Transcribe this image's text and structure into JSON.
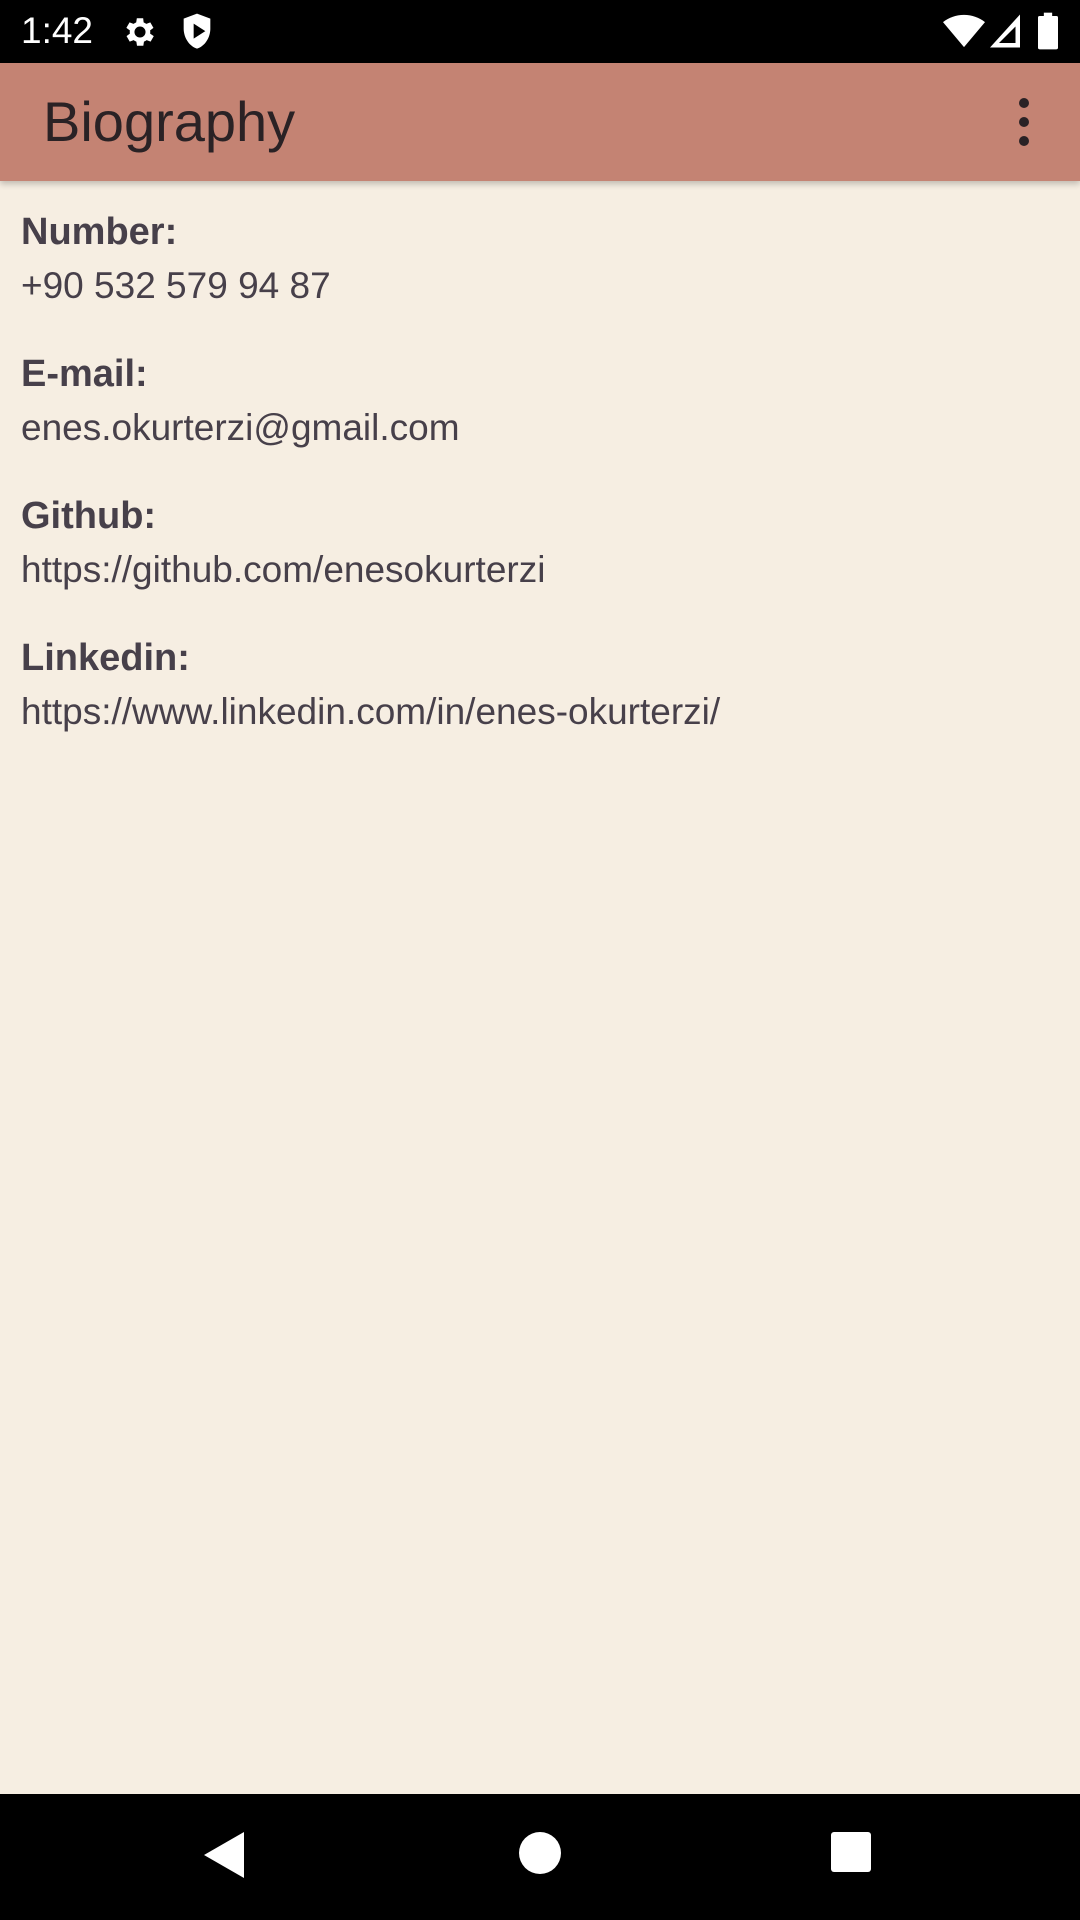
{
  "status_bar": {
    "time": "1:42",
    "icons": [
      "gear-icon",
      "shield-icon",
      "wifi-icon",
      "cell-signal-icon",
      "battery-icon"
    ]
  },
  "app_bar": {
    "title": "Biography",
    "menu_icon": "more-vert-icon"
  },
  "contact": {
    "number_label": "Number:",
    "number_value": "+90 532 579 94 87",
    "email_label": "E-mail:",
    "email_value": "enes.okurterzi@gmail.com",
    "github_label": "Github:",
    "github_value": "https://github.com/enesokurterzi",
    "linkedin_label": "Linkedin:",
    "linkedin_value": "https://www.linkedin.com/in/enes-okurterzi/"
  },
  "nav_bar": {
    "icons": [
      "back-icon",
      "home-icon",
      "recents-icon"
    ]
  },
  "colors": {
    "app_bar": "#c48373",
    "background": "#f6eee2",
    "text": "#47404a",
    "title_text": "#2a2225"
  }
}
